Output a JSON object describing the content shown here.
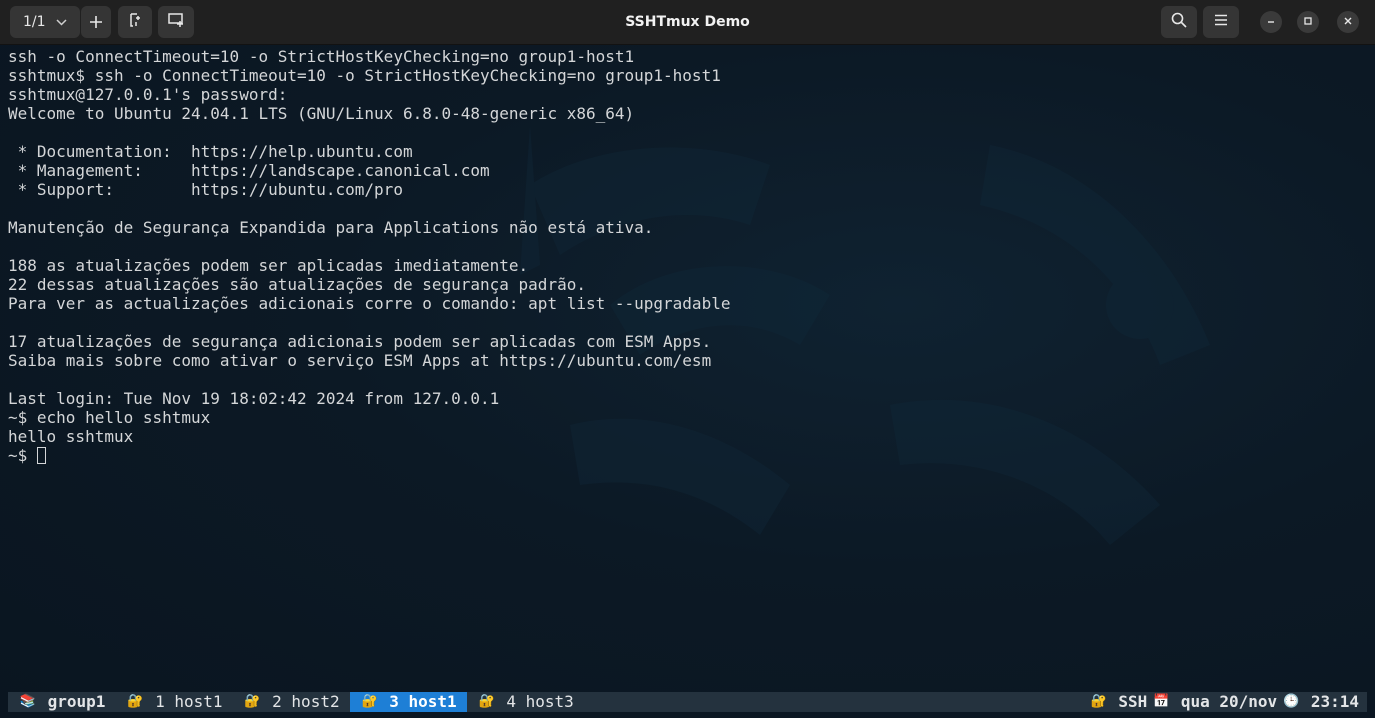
{
  "titlebar": {
    "tab_counter": "1/1",
    "title": "SSHTmux Demo",
    "buttons": {
      "tab_dropdown_icon": "chevron-down-icon",
      "new_tab_icon": "plus-icon",
      "detach_icon": "detach-tab-icon",
      "new_window_icon": "new-window-icon",
      "search_icon": "search-icon",
      "menu_icon": "hamburger-menu-icon",
      "minimize_icon": "minimize-icon",
      "maximize_icon": "maximize-icon",
      "close_icon": "close-icon"
    }
  },
  "terminal": {
    "lines": [
      "ssh -o ConnectTimeout=10 -o StrictHostKeyChecking=no group1-host1",
      "sshtmux$ ssh -o ConnectTimeout=10 -o StrictHostKeyChecking=no group1-host1",
      "sshtmux@127.0.0.1's password:",
      "Welcome to Ubuntu 24.04.1 LTS (GNU/Linux 6.8.0-48-generic x86_64)",
      "",
      " * Documentation:  https://help.ubuntu.com",
      " * Management:     https://landscape.canonical.com",
      " * Support:        https://ubuntu.com/pro",
      "",
      "Manutenção de Segurança Expandida para Applications não está ativa.",
      "",
      "188 as atualizações podem ser aplicadas imediatamente.",
      "22 dessas atualizações são atualizações de segurança padrão.",
      "Para ver as actualizações adicionais corre o comando: apt list --upgradable",
      "",
      "17 atualizações de segurança adicionais podem ser aplicadas com ESM Apps.",
      "Saiba mais sobre como ativar o serviço ESM Apps at https://ubuntu.com/esm",
      "",
      "Last login: Tue Nov 19 18:02:42 2024 from 127.0.0.1",
      "~$ echo hello sshtmux",
      "hello sshtmux"
    ],
    "prompt": "~$"
  },
  "statusbar": {
    "session": {
      "icon": "📚",
      "name": "group1"
    },
    "windows": [
      {
        "icon": "🔐",
        "label": "1 host1",
        "active": false
      },
      {
        "icon": "🔐",
        "label": "2 host2",
        "active": false
      },
      {
        "icon": "🔐",
        "label": "3 host1",
        "active": true
      },
      {
        "icon": "🔐",
        "label": "4 host3",
        "active": false
      }
    ],
    "right": {
      "ssh_icon": "🔐",
      "ssh_label": "SSH",
      "date_icon": "📅",
      "date": "qua 20/nov",
      "time_icon": "🕒",
      "time": "23:14"
    }
  },
  "colors": {
    "titlebar_bg": "#202020",
    "terminal_bg": "#0b1722",
    "terminal_fg": "#d4d6d8",
    "statusbar_bg": "#24323e",
    "active_window_bg": "#1e7fd6"
  }
}
